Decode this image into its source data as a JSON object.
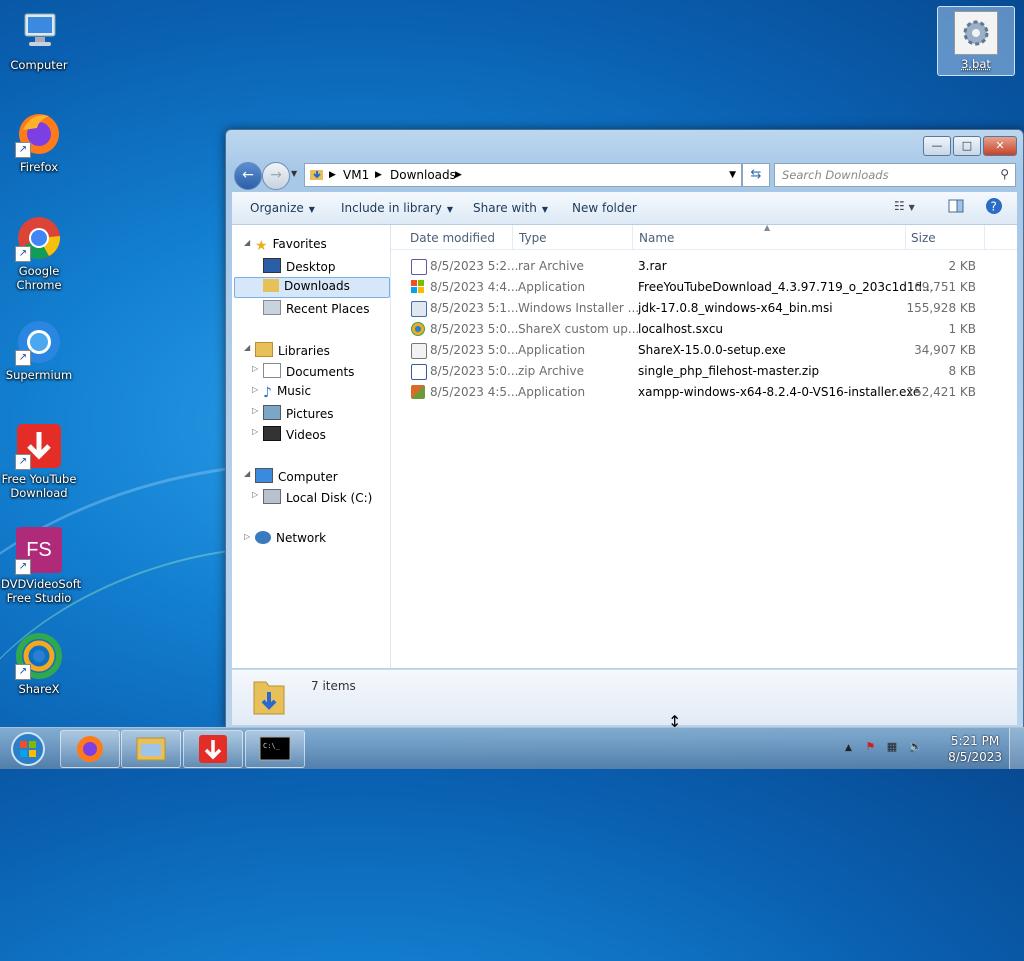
{
  "desktop": {
    "icons": [
      {
        "label": "Computer"
      },
      {
        "label": "Firefox"
      },
      {
        "label": "Google Chrome"
      },
      {
        "label": "Supermium"
      },
      {
        "label": "Free YouTube Download"
      },
      {
        "label": "DVDVideoSoft Free Studio",
        "badge": "FS"
      },
      {
        "label": "ShareX"
      }
    ],
    "selected_file": {
      "label": "3.bat"
    }
  },
  "window": {
    "caption": {
      "minimize": "—",
      "maximize": "□",
      "close": "✕"
    },
    "address": {
      "parts": [
        "VM1",
        "Downloads"
      ]
    },
    "search": {
      "placeholder": "Search Downloads"
    },
    "commands": {
      "organize": "Organize",
      "include": "Include in library",
      "share": "Share with",
      "new_folder": "New folder"
    },
    "nav": {
      "favorites": "Favorites",
      "desktop": "Desktop",
      "downloads": "Downloads",
      "recent": "Recent Places",
      "libraries": "Libraries",
      "documents": "Documents",
      "music": "Music",
      "pictures": "Pictures",
      "videos": "Videos",
      "computer": "Computer",
      "local_disk": "Local Disk (C:)",
      "network": "Network"
    },
    "columns": {
      "date": "Date modified",
      "type": "Type",
      "name": "Name",
      "size": "Size"
    },
    "files": [
      {
        "date": "8/5/2023 5:2...",
        "type": "rar Archive",
        "name": "3.rar",
        "size": "2 KB",
        "icon": "rar-icon",
        "color": "#5a5aa8"
      },
      {
        "date": "8/5/2023 4:4...",
        "type": "Application",
        "name": "FreeYouTubeDownload_4.3.97.719_o_203c1d1d...",
        "size": "69,751 KB",
        "icon": "windows-installer-icon",
        "color": "#e0492b"
      },
      {
        "date": "8/5/2023 5:1...",
        "type": "Windows Installer ...",
        "name": "jdk-17.0.8_windows-x64_bin.msi",
        "size": "155,928 KB",
        "icon": "msi-icon",
        "color": "#3f6fb0"
      },
      {
        "date": "8/5/2023 5:0...",
        "type": "ShareX custom up...",
        "name": "localhost.sxcu",
        "size": "1 KB",
        "icon": "sharex-icon",
        "color": "#f08a24"
      },
      {
        "date": "8/5/2023 5:0...",
        "type": "Application",
        "name": "ShareX-15.0.0-setup.exe",
        "size": "34,907 KB",
        "icon": "setup-icon",
        "color": "#6a8a6a"
      },
      {
        "date": "8/5/2023 5:0...",
        "type": "zip Archive",
        "name": "single_php_filehost-master.zip",
        "size": "8 KB",
        "icon": "zip-icon",
        "color": "#3a5a9a"
      },
      {
        "date": "8/5/2023 4:5...",
        "type": "Application",
        "name": "xampp-windows-x64-8.2.4-0-VS16-installer.exe",
        "size": "152,421 KB",
        "icon": "xampp-icon",
        "color": "#d96a2a"
      }
    ],
    "status": {
      "count": "7 items"
    }
  },
  "taskbar": {
    "clock": {
      "time": "5:21 PM",
      "date": "8/5/2023"
    }
  }
}
